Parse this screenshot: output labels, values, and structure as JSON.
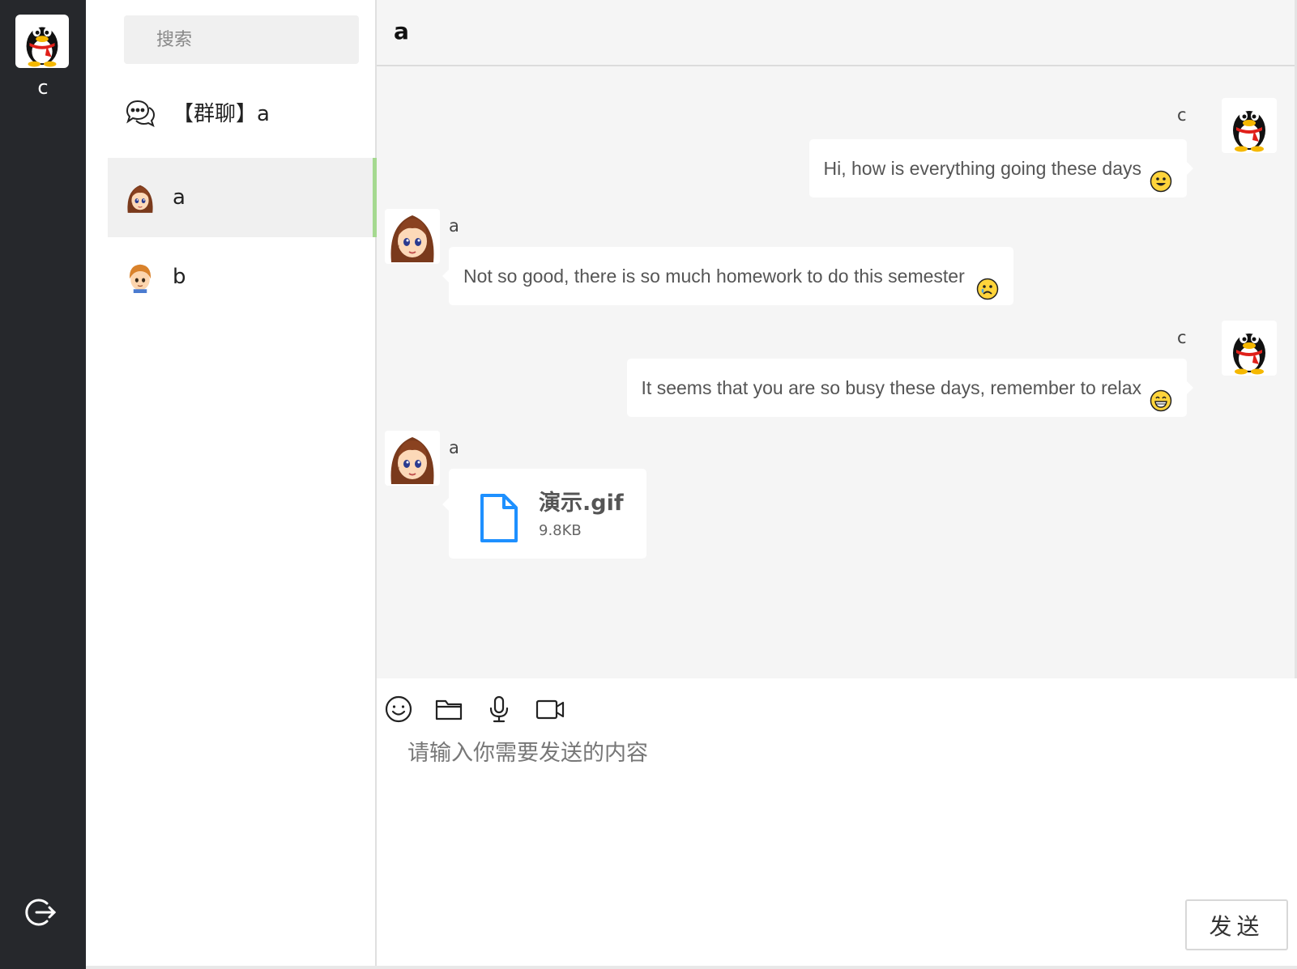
{
  "user": {
    "name": "c"
  },
  "search": {
    "placeholder": "搜索"
  },
  "conversations": [
    {
      "label": "【群聊】a",
      "icon": "chat-bubbles-icon",
      "active": false
    },
    {
      "label": "a",
      "icon": "girl-avatar",
      "active": true
    },
    {
      "label": "b",
      "icon": "boy-avatar",
      "active": false
    }
  ],
  "chat": {
    "title": "a",
    "messages": [
      {
        "sender": "c",
        "side": "right",
        "text": "Hi, how is everything going these days",
        "emoji": "smile-emoji"
      },
      {
        "sender": "a",
        "side": "left",
        "text": "Not so good, there is so much homework to do this semester",
        "emoji": "sad-emoji"
      },
      {
        "sender": "c",
        "side": "right",
        "text": "It seems that you are so busy these days, remember to relax",
        "emoji": "grin-emoji"
      },
      {
        "sender": "a",
        "side": "left",
        "file": {
          "name": "演示.gif",
          "size": "9.8KB"
        }
      }
    ]
  },
  "composer": {
    "tools": [
      "emoji-icon",
      "folder-icon",
      "microphone-icon",
      "video-icon"
    ],
    "placeholder": "请输入你需要发送的内容",
    "send_label": "发送"
  },
  "colors": {
    "rail": "#26282c",
    "active_indicator": "#a5d990",
    "file_icon": "#1e90ff"
  }
}
